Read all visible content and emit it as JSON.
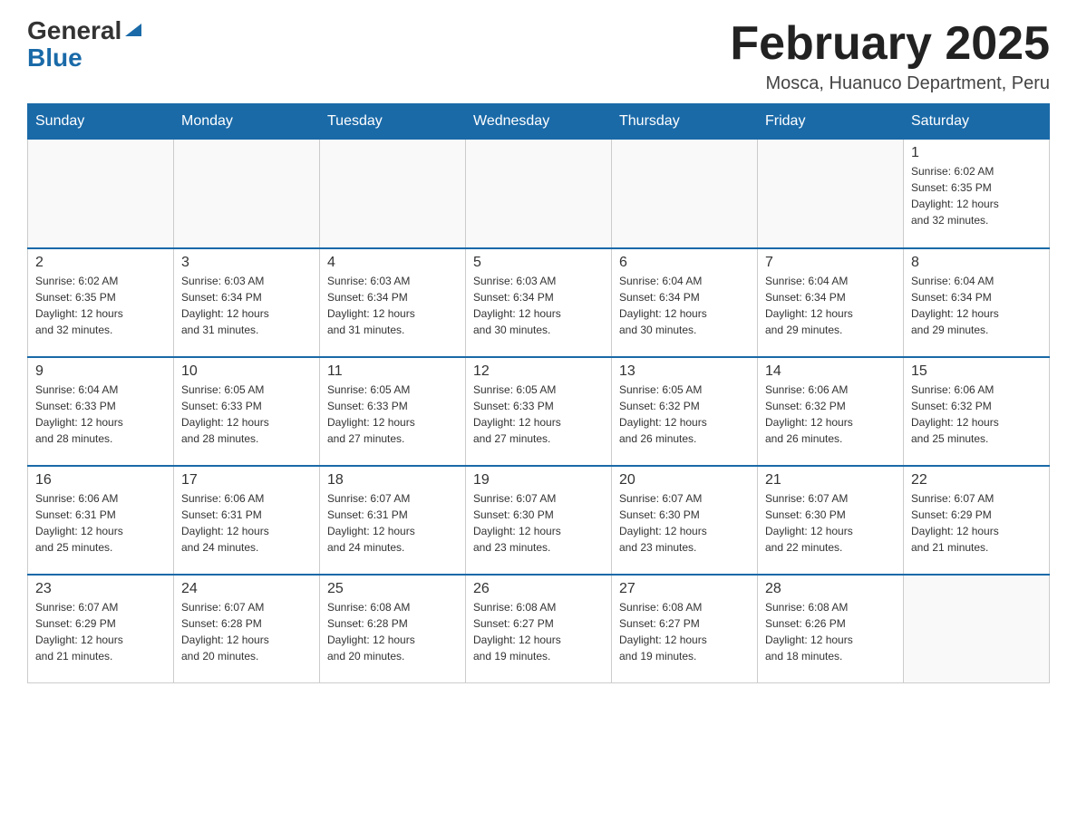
{
  "logo": {
    "general": "General",
    "blue": "Blue",
    "arrowSymbol": "▶"
  },
  "title": "February 2025",
  "subtitle": "Mosca, Huanuco Department, Peru",
  "weekdays": [
    "Sunday",
    "Monday",
    "Tuesday",
    "Wednesday",
    "Thursday",
    "Friday",
    "Saturday"
  ],
  "weeks": [
    [
      {
        "day": "",
        "info": ""
      },
      {
        "day": "",
        "info": ""
      },
      {
        "day": "",
        "info": ""
      },
      {
        "day": "",
        "info": ""
      },
      {
        "day": "",
        "info": ""
      },
      {
        "day": "",
        "info": ""
      },
      {
        "day": "1",
        "info": "Sunrise: 6:02 AM\nSunset: 6:35 PM\nDaylight: 12 hours\nand 32 minutes."
      }
    ],
    [
      {
        "day": "2",
        "info": "Sunrise: 6:02 AM\nSunset: 6:35 PM\nDaylight: 12 hours\nand 32 minutes."
      },
      {
        "day": "3",
        "info": "Sunrise: 6:03 AM\nSunset: 6:34 PM\nDaylight: 12 hours\nand 31 minutes."
      },
      {
        "day": "4",
        "info": "Sunrise: 6:03 AM\nSunset: 6:34 PM\nDaylight: 12 hours\nand 31 minutes."
      },
      {
        "day": "5",
        "info": "Sunrise: 6:03 AM\nSunset: 6:34 PM\nDaylight: 12 hours\nand 30 minutes."
      },
      {
        "day": "6",
        "info": "Sunrise: 6:04 AM\nSunset: 6:34 PM\nDaylight: 12 hours\nand 30 minutes."
      },
      {
        "day": "7",
        "info": "Sunrise: 6:04 AM\nSunset: 6:34 PM\nDaylight: 12 hours\nand 29 minutes."
      },
      {
        "day": "8",
        "info": "Sunrise: 6:04 AM\nSunset: 6:34 PM\nDaylight: 12 hours\nand 29 minutes."
      }
    ],
    [
      {
        "day": "9",
        "info": "Sunrise: 6:04 AM\nSunset: 6:33 PM\nDaylight: 12 hours\nand 28 minutes."
      },
      {
        "day": "10",
        "info": "Sunrise: 6:05 AM\nSunset: 6:33 PM\nDaylight: 12 hours\nand 28 minutes."
      },
      {
        "day": "11",
        "info": "Sunrise: 6:05 AM\nSunset: 6:33 PM\nDaylight: 12 hours\nand 27 minutes."
      },
      {
        "day": "12",
        "info": "Sunrise: 6:05 AM\nSunset: 6:33 PM\nDaylight: 12 hours\nand 27 minutes."
      },
      {
        "day": "13",
        "info": "Sunrise: 6:05 AM\nSunset: 6:32 PM\nDaylight: 12 hours\nand 26 minutes."
      },
      {
        "day": "14",
        "info": "Sunrise: 6:06 AM\nSunset: 6:32 PM\nDaylight: 12 hours\nand 26 minutes."
      },
      {
        "day": "15",
        "info": "Sunrise: 6:06 AM\nSunset: 6:32 PM\nDaylight: 12 hours\nand 25 minutes."
      }
    ],
    [
      {
        "day": "16",
        "info": "Sunrise: 6:06 AM\nSunset: 6:31 PM\nDaylight: 12 hours\nand 25 minutes."
      },
      {
        "day": "17",
        "info": "Sunrise: 6:06 AM\nSunset: 6:31 PM\nDaylight: 12 hours\nand 24 minutes."
      },
      {
        "day": "18",
        "info": "Sunrise: 6:07 AM\nSunset: 6:31 PM\nDaylight: 12 hours\nand 24 minutes."
      },
      {
        "day": "19",
        "info": "Sunrise: 6:07 AM\nSunset: 6:30 PM\nDaylight: 12 hours\nand 23 minutes."
      },
      {
        "day": "20",
        "info": "Sunrise: 6:07 AM\nSunset: 6:30 PM\nDaylight: 12 hours\nand 23 minutes."
      },
      {
        "day": "21",
        "info": "Sunrise: 6:07 AM\nSunset: 6:30 PM\nDaylight: 12 hours\nand 22 minutes."
      },
      {
        "day": "22",
        "info": "Sunrise: 6:07 AM\nSunset: 6:29 PM\nDaylight: 12 hours\nand 21 minutes."
      }
    ],
    [
      {
        "day": "23",
        "info": "Sunrise: 6:07 AM\nSunset: 6:29 PM\nDaylight: 12 hours\nand 21 minutes."
      },
      {
        "day": "24",
        "info": "Sunrise: 6:07 AM\nSunset: 6:28 PM\nDaylight: 12 hours\nand 20 minutes."
      },
      {
        "day": "25",
        "info": "Sunrise: 6:08 AM\nSunset: 6:28 PM\nDaylight: 12 hours\nand 20 minutes."
      },
      {
        "day": "26",
        "info": "Sunrise: 6:08 AM\nSunset: 6:27 PM\nDaylight: 12 hours\nand 19 minutes."
      },
      {
        "day": "27",
        "info": "Sunrise: 6:08 AM\nSunset: 6:27 PM\nDaylight: 12 hours\nand 19 minutes."
      },
      {
        "day": "28",
        "info": "Sunrise: 6:08 AM\nSunset: 6:26 PM\nDaylight: 12 hours\nand 18 minutes."
      },
      {
        "day": "",
        "info": ""
      }
    ]
  ]
}
